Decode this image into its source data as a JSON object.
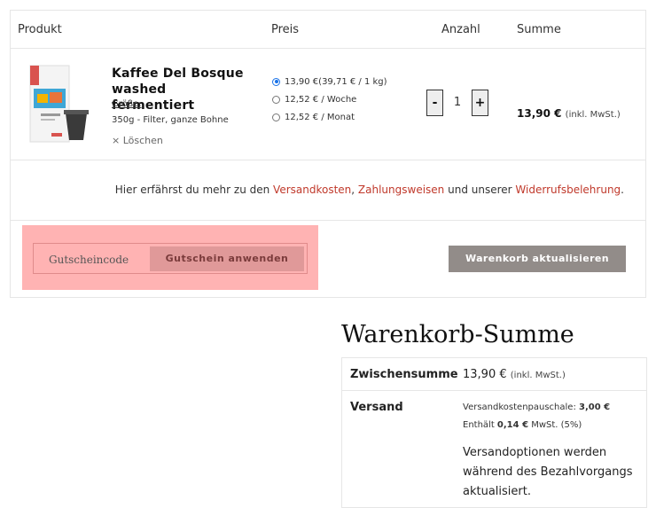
{
  "cart": {
    "headers": {
      "product": "Produkt",
      "price": "Preis",
      "quantity": "Anzahl",
      "total": "Summe"
    },
    "item": {
      "name_line1": "Kaffee Del Bosque",
      "name_line2": "washed fermentiert",
      "size_label": "Größe:",
      "size_value": "350g - Filter, ganze Bohne",
      "remove_label": "× Löschen",
      "price_options": [
        {
          "label": "13,90 €(39,71 € / 1 kg)",
          "selected": true
        },
        {
          "label": "12,52 € / Woche",
          "selected": false
        },
        {
          "label": "12,52 € / Monat",
          "selected": false
        }
      ],
      "qty_minus": "-",
      "quantity": "1",
      "qty_plus": "+",
      "line_total": "13,90 €",
      "line_total_tax": "(inkl. MwSt.)"
    },
    "info": {
      "prefix": "Hier erfährst du mehr zu den ",
      "link1": "Versandkosten",
      "sep": ", ",
      "link2": "Zahlungsweisen",
      "mid": " und unserer ",
      "link3": "Widerrufsbelehrung",
      "suffix": "."
    },
    "coupon": {
      "placeholder": "Gutscheincode",
      "apply_label": "Gutschein anwenden"
    },
    "update_label": "Warenkorb aktualisieren"
  },
  "totals": {
    "title": "Warenkorb-Summe",
    "subtotal_label": "Zwischensumme",
    "subtotal_value": "13,90 €",
    "subtotal_tax": "(inkl. MwSt.)",
    "shipping_label": "Versand",
    "shipping_fee_label": "Versandkostenpauschale: ",
    "shipping_fee_value": "3,00 €",
    "shipping_tax_prefix": "Enthält ",
    "shipping_tax_value": "0,14 €",
    "shipping_tax_suffix": " MwSt. (5%)",
    "shipping_note": "Versandoptionen werden während des Bezahlvorgangs aktualisiert."
  },
  "colors": {
    "link": "#c0392b",
    "highlight": "#ffb3b3",
    "update_button": "#928c89",
    "radio_checked": "#1a73e8"
  },
  "icons": {
    "remove": "close-icon",
    "product_image": "coffee-bag-image"
  }
}
